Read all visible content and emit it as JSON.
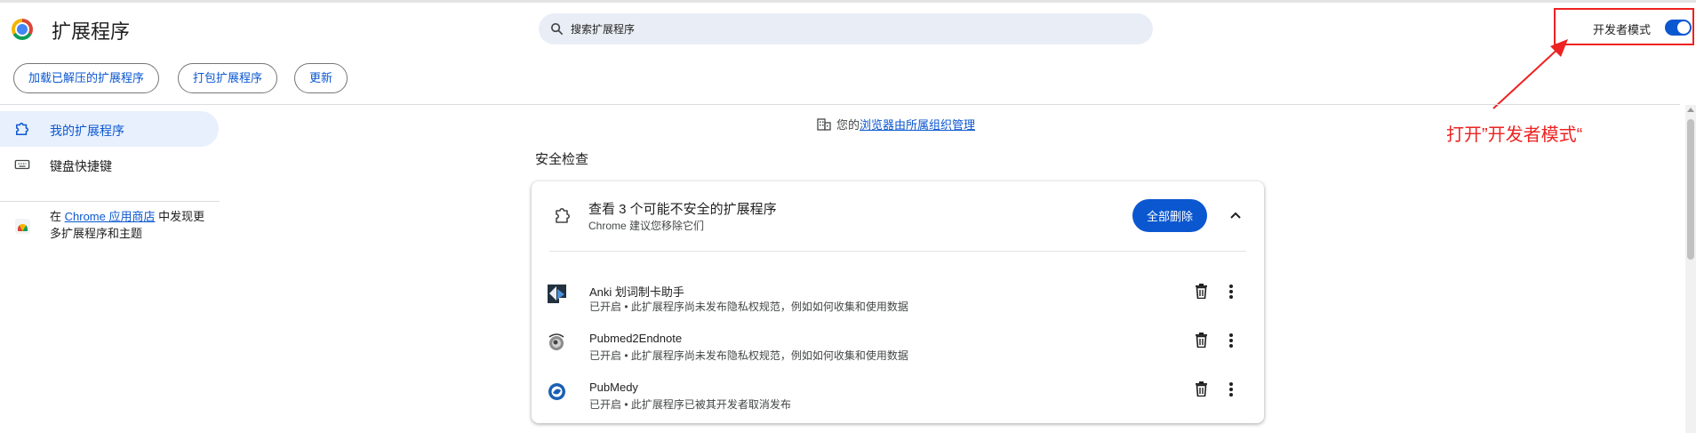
{
  "header": {
    "title": "扩展程序",
    "search_placeholder": "搜索扩展程序",
    "dev_mode_label": "开发者模式",
    "dev_mode_on": true
  },
  "toolbar": {
    "load_unpacked": "加载已解压的扩展程序",
    "pack": "打包扩展程序",
    "update": "更新"
  },
  "annotation": {
    "text": "打开”开发者模式“",
    "color": "#ee2222"
  },
  "sidebar": {
    "items": [
      {
        "label": "我的扩展程序",
        "icon": "puzzle-icon",
        "active": true
      },
      {
        "label": "键盘快捷键",
        "icon": "keyboard-icon",
        "active": false
      }
    ],
    "store": {
      "prefix": "在 ",
      "link": "Chrome 应用商店",
      "suffix": " 中发现更多扩展程序和主题"
    }
  },
  "managed": {
    "prefix": "您的",
    "link": "浏览器由所属组织管理"
  },
  "safety": {
    "section_title": "安全检查",
    "title": "查看 3 个可能不安全的扩展程序",
    "subtitle": "Chrome 建议您移除它们",
    "remove_all": "全部删除",
    "extensions": [
      {
        "name": "Anki 划词制卡助手",
        "status": "已开启 • 此扩展程序尚未发布隐私权规范，例如如何收集和使用数据"
      },
      {
        "name": "Pubmed2Endnote",
        "status": "已开启 • 此扩展程序尚未发布隐私权规范，例如如何收集和使用数据"
      },
      {
        "name": "PubMedy",
        "status": "已开启 • 此扩展程序已被其开发者取消发布"
      }
    ]
  },
  "colors": {
    "accent": "#0b57d0",
    "annotation": "#ee2222",
    "search_bg": "#e9eef6",
    "active_nav": "#e8f0fe"
  }
}
